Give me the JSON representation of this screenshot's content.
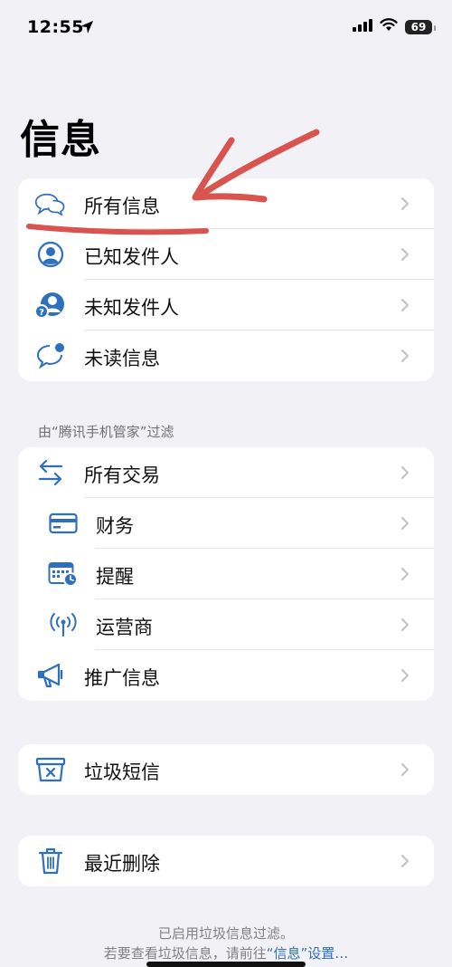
{
  "status_bar": {
    "time": "12:55",
    "battery": "69"
  },
  "page": {
    "title": "信息"
  },
  "group1": {
    "items": [
      {
        "label": "所有信息"
      },
      {
        "label": "已知发件人"
      },
      {
        "label": "未知发件人"
      },
      {
        "label": "未读信息"
      }
    ]
  },
  "filter_section": {
    "header": "由“腾讯手机管家”过滤",
    "items": [
      {
        "label": "所有交易"
      },
      {
        "label": "财务"
      },
      {
        "label": "提醒"
      },
      {
        "label": "运营商"
      },
      {
        "label": "推广信息"
      }
    ]
  },
  "junk": {
    "label": "垃圾短信"
  },
  "recent": {
    "label": "最近删除"
  },
  "footer": {
    "line1": "已启用垃圾信息过滤。",
    "line2_prefix": "若要查看垃圾信息，请前往",
    "line2_link": "“信息”设置…"
  },
  "colors": {
    "accent": "#2f6fbf",
    "annotation": "#d9534f",
    "background": "#f2f2f6"
  }
}
